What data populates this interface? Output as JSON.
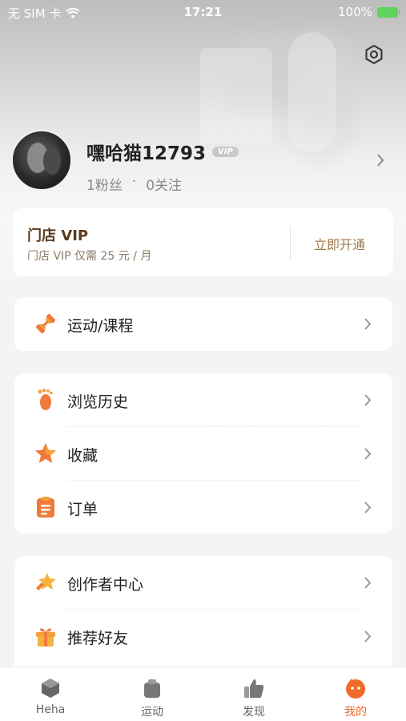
{
  "status_bar": {
    "carrier": "无 SIM 卡",
    "time": "17:21",
    "battery": "100%"
  },
  "profile": {
    "username": "嘿哈猫12793",
    "vip_badge": "VIP",
    "fans": "1粉丝",
    "dot": "·",
    "following": "0关注"
  },
  "vip_card": {
    "title": "门店 VIP",
    "subtitle": "门店 VIP 仅需 25 元 / 月",
    "action": "立即开通"
  },
  "menu": {
    "sports": {
      "label": "运动/课程",
      "icon": "dumbbell-icon"
    },
    "history": {
      "label": "浏览历史",
      "icon": "footprint-icon"
    },
    "favorites": {
      "label": "收藏",
      "icon": "star-icon"
    },
    "orders": {
      "label": "订单",
      "icon": "clipboard-icon"
    },
    "creator": {
      "label": "创作者中心",
      "icon": "creator-star-icon"
    },
    "invite": {
      "label": "推荐好友",
      "icon": "gift-icon"
    }
  },
  "tabs": [
    {
      "label": "Heha",
      "icon": "heha-cube-icon"
    },
    {
      "label": "运动",
      "icon": "bag-icon"
    },
    {
      "label": "发现",
      "icon": "thumbs-up-icon"
    },
    {
      "label": "我的",
      "icon": "me-face-icon"
    }
  ],
  "colors": {
    "accent": "#f26a2a",
    "vip_text": "#5a3a1c",
    "vip_action": "#a07a4e",
    "background": "#f4f4f5"
  }
}
